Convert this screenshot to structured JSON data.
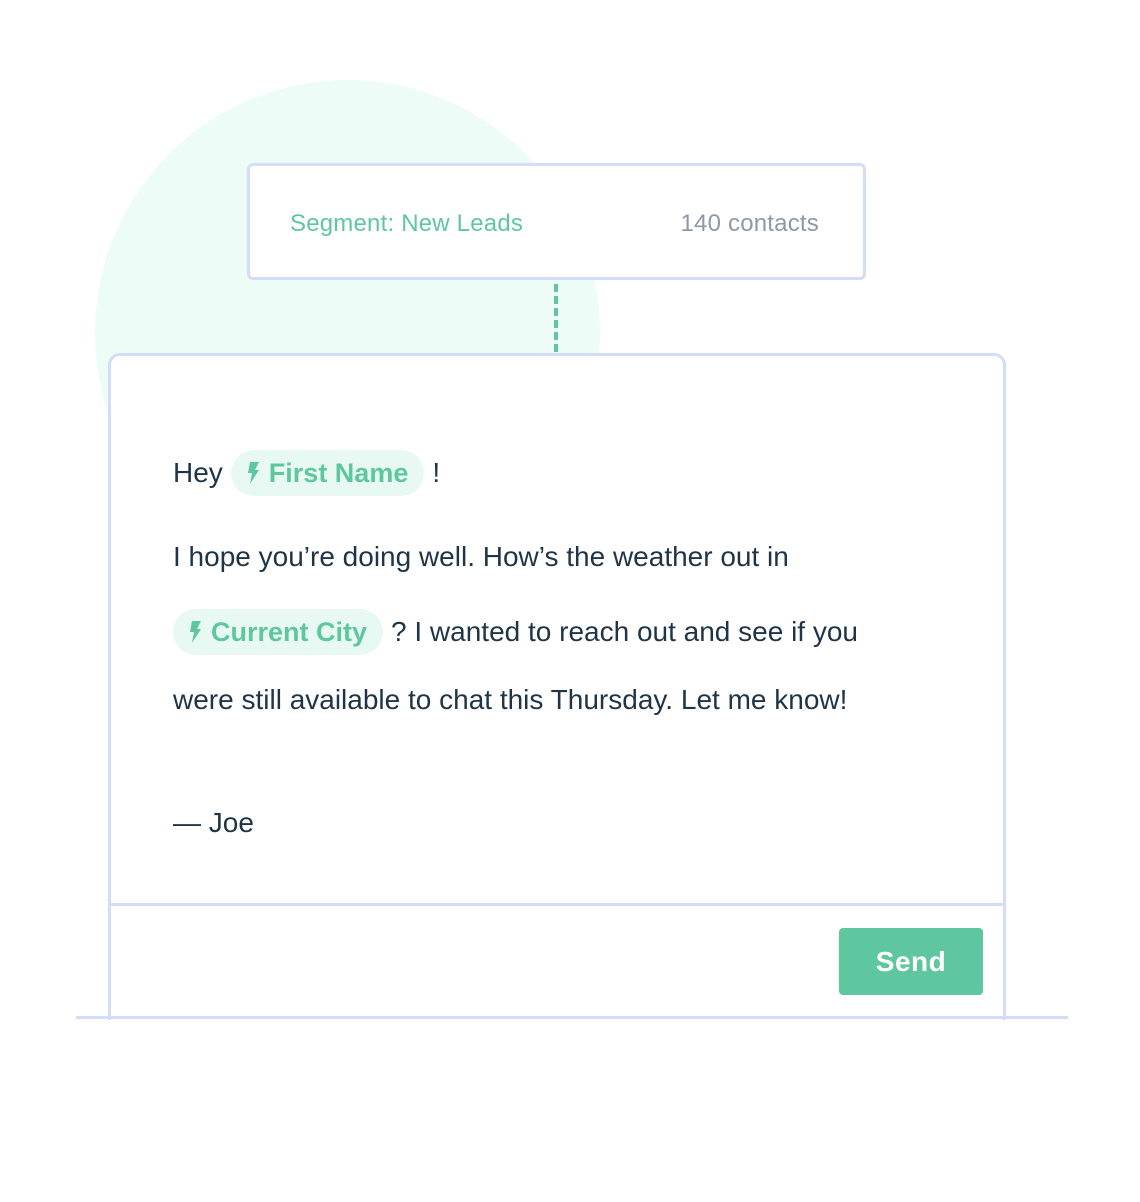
{
  "segment": {
    "label": "Segment: New Leads",
    "count": "140 contacts"
  },
  "email": {
    "greeting": "Hey",
    "greeting_end": "!",
    "first_name_token": "First Name",
    "line1": "I hope you’re doing well. How’s the weather out in",
    "current_city_token": "Current City",
    "line2_after": "? I wanted to reach out and see if you",
    "line3": "were still available to chat this Thursday. Let me know!",
    "signature": "— Joe"
  },
  "actions": {
    "send_label": "Send"
  },
  "icons": {
    "token_icon": "lightning-bolt-icon"
  },
  "colors": {
    "accent": "#5fc7a0",
    "chip_background": "#e7f9f2",
    "border": "#d3ddf7",
    "text": "#1f3547",
    "muted": "#8e98a8",
    "circle": "#edfcf7"
  }
}
